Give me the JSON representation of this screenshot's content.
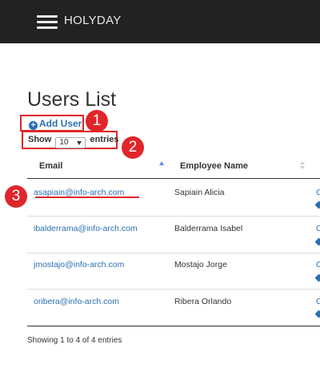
{
  "navbar": {
    "brand": "HOLYDAY"
  },
  "page": {
    "title": "Users List"
  },
  "toolbar": {
    "add_user_label": "Add User",
    "show_label": "Show",
    "entries_label": "entries",
    "page_size": "10"
  },
  "callouts": [
    "1",
    "2",
    "3"
  ],
  "table": {
    "columns": [
      "Email",
      "Employee Name"
    ],
    "rows": [
      {
        "email": "asapiain@info-arch.com",
        "name": "Sapiain Alicia",
        "action": "C"
      },
      {
        "email": "ibalderrama@info-arch.com",
        "name": "Balderrama Isabel",
        "action": "C"
      },
      {
        "email": "jmostajo@info-arch.com",
        "name": "Mostajo Jorge",
        "action": "C"
      },
      {
        "email": "oribera@info-arch.com",
        "name": "Ribera Orlando",
        "action": "C"
      }
    ]
  },
  "footer": {
    "info": "Showing 1 to 4 of 4 entries"
  },
  "colors": {
    "navbar": "#222222",
    "link": "#2a6fb4",
    "annotation": "#e0262a"
  }
}
